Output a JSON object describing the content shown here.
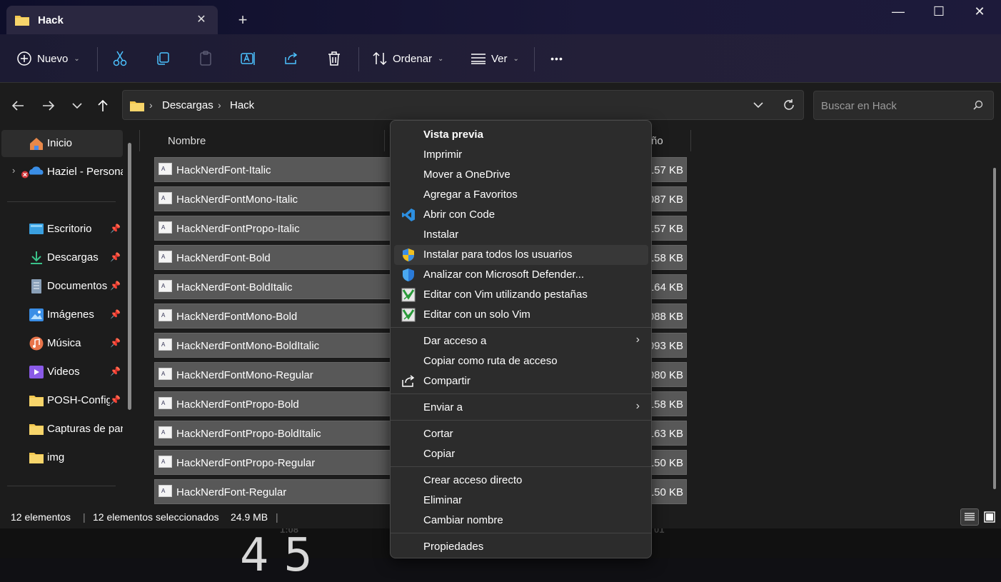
{
  "tab": {
    "title": "Hack",
    "close": "✕",
    "new": "+"
  },
  "window_controls": {
    "minimize": "—",
    "maximize": "☐",
    "close": "✕"
  },
  "toolbar": {
    "new_label": "Nuevo",
    "sort_label": "Ordenar",
    "view_label": "Ver",
    "more_label": "•••"
  },
  "address": {
    "crumbs": [
      "Descargas",
      "Hack"
    ]
  },
  "search": {
    "placeholder": "Buscar en Hack"
  },
  "sidebar": {
    "home": "Inicio",
    "onedrive": "Haziel - Personal",
    "items": [
      {
        "label": "Escritorio",
        "icon": "desktop-icon"
      },
      {
        "label": "Descargas",
        "icon": "download-icon"
      },
      {
        "label": "Documentos",
        "icon": "document-icon"
      },
      {
        "label": "Imágenes",
        "icon": "pictures-icon"
      },
      {
        "label": "Música",
        "icon": "music-icon"
      },
      {
        "label": "Videos",
        "icon": "videos-icon"
      },
      {
        "label": "POSH-Config",
        "icon": "folder-icon"
      },
      {
        "label": "Capturas de pantalla",
        "icon": "folder-icon"
      },
      {
        "label": "img",
        "icon": "folder-icon"
      }
    ]
  },
  "columns": {
    "name": "Nombre",
    "size_partial": "ño"
  },
  "files": [
    {
      "name": "HackNerdFont-Italic",
      "size": "157 KB"
    },
    {
      "name": "HackNerdFontMono-Italic",
      "size": "087 KB"
    },
    {
      "name": "HackNerdFontPropo-Italic",
      "size": "157 KB"
    },
    {
      "name": "HackNerdFont-Bold",
      "size": "158 KB"
    },
    {
      "name": "HackNerdFont-BoldItalic",
      "size": "164 KB"
    },
    {
      "name": "HackNerdFontMono-Bold",
      "size": "088 KB"
    },
    {
      "name": "HackNerdFontMono-BoldItalic",
      "size": "093 KB"
    },
    {
      "name": "HackNerdFontMono-Regular",
      "size": "080 KB"
    },
    {
      "name": "HackNerdFontPropo-Bold",
      "size": "158 KB"
    },
    {
      "name": "HackNerdFontPropo-BoldItalic",
      "size": "163 KB"
    },
    {
      "name": "HackNerdFontPropo-Regular",
      "size": "150 KB"
    },
    {
      "name": "HackNerdFont-Regular",
      "size": "150 KB"
    }
  ],
  "status": {
    "count": "12 elementos",
    "selected": "12 elementos seleccionados",
    "size": "24.9 MB"
  },
  "background": {
    "time_left": "1:08",
    "time_right": "01",
    "big_digit": "4 5"
  },
  "context_menu": {
    "items": [
      {
        "label": "Vista previa",
        "bold": true
      },
      {
        "label": "Imprimir"
      },
      {
        "label": "Mover a OneDrive"
      },
      {
        "label": "Agregar a Favoritos"
      },
      {
        "label": "Abrir con Code",
        "icon": "vscode-icon"
      },
      {
        "label": "Instalar"
      },
      {
        "label": "Instalar para todos los usuarios",
        "icon": "uac-shield-icon",
        "highlighted": true
      },
      {
        "label": "Analizar con Microsoft Defender...",
        "icon": "defender-shield-icon"
      },
      {
        "label": "Editar con Vim utilizando pestañas",
        "icon": "vim-icon"
      },
      {
        "label": "Editar con un solo Vim",
        "icon": "vim-icon"
      },
      {
        "label": "Dar acceso a",
        "submenu": true
      },
      {
        "label": "Copiar como ruta de acceso"
      },
      {
        "label": "Compartir",
        "icon": "share-icon"
      },
      {
        "label": "Enviar a",
        "submenu": true
      },
      {
        "label": "Cortar"
      },
      {
        "label": "Copiar"
      },
      {
        "label": "Crear acceso directo"
      },
      {
        "label": "Eliminar"
      },
      {
        "label": "Cambiar nombre"
      },
      {
        "label": "Propiedades"
      }
    ]
  },
  "colors": {
    "accent": "#4cc2ff",
    "folder": "#f3c74e",
    "selection": "#585858"
  }
}
